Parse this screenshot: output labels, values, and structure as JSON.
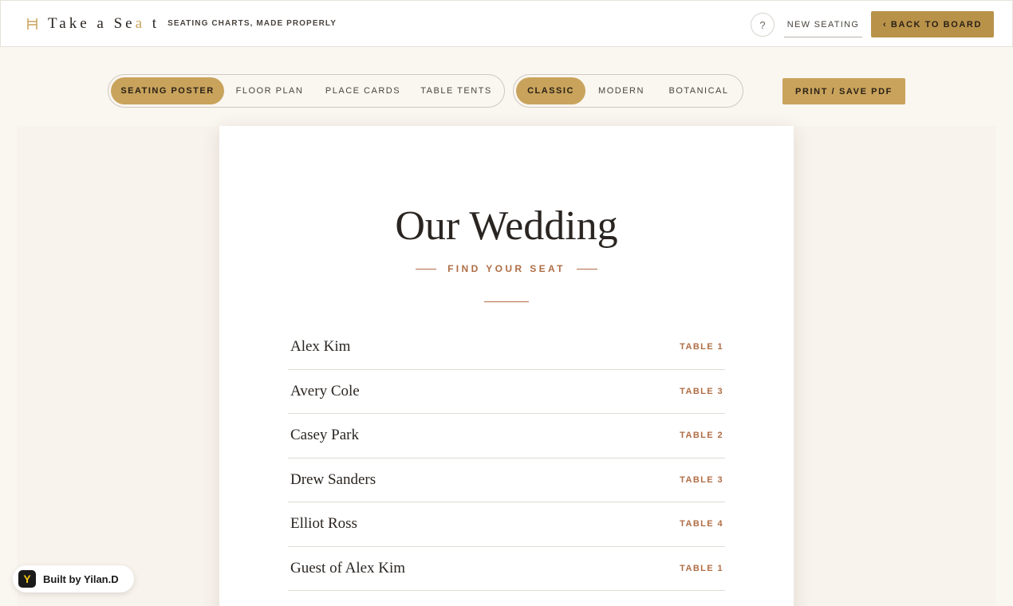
{
  "header": {
    "brand_name_pre": "Take a Se",
    "brand_name_accent": "a",
    "brand_name_post": "t",
    "tagline": "SEATING CHARTS, MADE PROPERLY",
    "help_label": "?",
    "new_seating_label": "NEW SEATING",
    "back_label": "‹ BACK TO BOARD",
    "brand_icon": "chair-icon"
  },
  "toolbar": {
    "type_tabs": [
      {
        "label": "SEATING POSTER",
        "active": true
      },
      {
        "label": "FLOOR PLAN",
        "active": false
      },
      {
        "label": "PLACE CARDS",
        "active": false
      },
      {
        "label": "TABLE TENTS",
        "active": false
      }
    ],
    "style_tabs": [
      {
        "label": "CLASSIC",
        "active": true
      },
      {
        "label": "MODERN",
        "active": false
      },
      {
        "label": "BOTANICAL",
        "active": false
      }
    ],
    "print_label": "PRINT / SAVE PDF"
  },
  "poster": {
    "title": "Our Wedding",
    "subtitle": "FIND YOUR SEAT",
    "guests": [
      {
        "name": "Alex Kim",
        "table": "TABLE 1"
      },
      {
        "name": "Avery Cole",
        "table": "TABLE 3"
      },
      {
        "name": "Casey Park",
        "table": "TABLE 2"
      },
      {
        "name": "Drew Sanders",
        "table": "TABLE 3"
      },
      {
        "name": "Elliot Ross",
        "table": "TABLE 4"
      },
      {
        "name": "Guest of Alex Kim",
        "table": "TABLE 1"
      }
    ]
  },
  "badge": {
    "logo": "Y",
    "text": "Built by Yilan.D"
  },
  "colors": {
    "accent_gold": "#c9a35c",
    "accent_gold_dark": "#b9924a",
    "accent_rust": "#b06d45",
    "background": "#faf6f0"
  }
}
